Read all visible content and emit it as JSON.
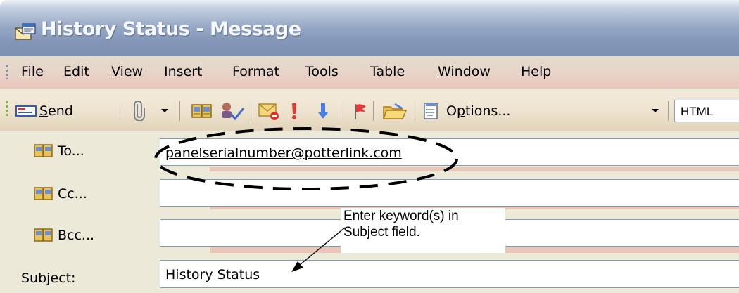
{
  "window": {
    "title": "History Status - Message"
  },
  "menu": {
    "items": [
      {
        "pre": "",
        "u": "F",
        "post": "ile"
      },
      {
        "pre": "",
        "u": "E",
        "post": "dit"
      },
      {
        "pre": "",
        "u": "V",
        "post": "iew"
      },
      {
        "pre": "",
        "u": "I",
        "post": "nsert"
      },
      {
        "pre": "F",
        "u": "o",
        "post": "rmat"
      },
      {
        "pre": "",
        "u": "T",
        "post": "ools"
      },
      {
        "pre": "T",
        "u": "a",
        "post": "ble"
      },
      {
        "pre": "",
        "u": "W",
        "post": "indow"
      },
      {
        "pre": "",
        "u": "H",
        "post": "elp"
      }
    ]
  },
  "toolbar": {
    "send": {
      "pre": "",
      "u": "S",
      "post": "end"
    },
    "options": {
      "pre": "O",
      "u": "p",
      "post": "tions..."
    },
    "format": "HTML",
    "icons": [
      "send-icon",
      "attach-icon",
      "address-book-icon",
      "check-names-icon",
      "permission-icon",
      "high-importance-icon",
      "low-importance-icon",
      "follow-up-flag-icon",
      "open-folder-icon",
      "options-icon"
    ]
  },
  "compose": {
    "to_label": "To...",
    "cc_label": "Cc...",
    "bcc_label": "Bcc...",
    "subject_label": "Subject:",
    "to_value": "panelserialnumber@potterlink.com",
    "cc_value": "",
    "bcc_value": "",
    "subject_value": "History Status"
  },
  "annotation": {
    "line1": "Enter keyword(s) in",
    "line2": "Subject field."
  }
}
